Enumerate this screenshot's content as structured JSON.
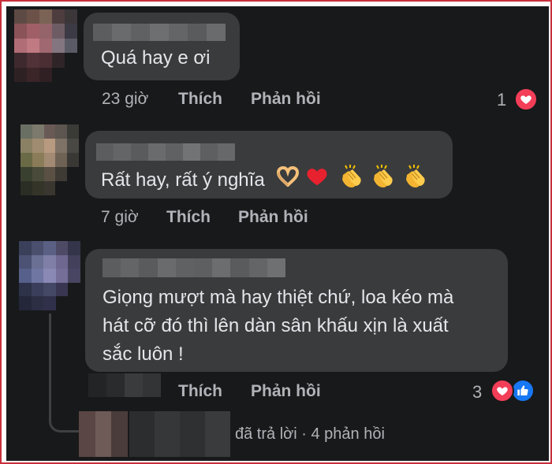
{
  "comments": [
    {
      "text": "Quá hay e ơi",
      "time": "23 giờ",
      "like_label": "Thích",
      "reply_label": "Phản hồi",
      "reaction_count": "1",
      "reactions": [
        "heart-icon"
      ]
    },
    {
      "text": "Rất hay, rất ý nghĩa",
      "emojis": [
        "heart-hands-emoji",
        "red-heart-emoji",
        "clapping-hands-emoji",
        "clapping-hands-emoji",
        "clapping-hands-emoji"
      ],
      "time": "7 giờ",
      "like_label": "Thích",
      "reply_label": "Phản hồi"
    },
    {
      "text_lines": [
        "Giọng mượt mà hay thiệt chứ, loa kéo mà",
        "hát cỡ đó thì lên dàn sân khấu xịn là xuất",
        "sắc luôn !"
      ],
      "like_label": "Thích",
      "reply_label": "Phản hồi",
      "reaction_count": "3",
      "reactions": [
        "heart-icon",
        "like-icon"
      ]
    }
  ],
  "reply_summary": {
    "replied_label": "đã trả lời",
    "separator": "·",
    "count_label": "4 phản hồi"
  },
  "colors": {
    "background": "#18191a",
    "bubble": "#3a3b3c",
    "text": "#e4e6eb",
    "meta": "#b0b3b8",
    "heart": "#f33e58",
    "like": "#1877f2",
    "frame_border": "#c8303c"
  }
}
